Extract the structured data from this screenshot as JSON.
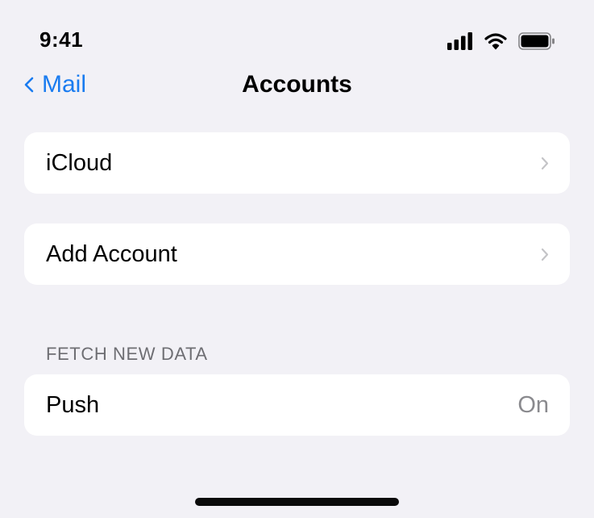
{
  "status_bar": {
    "time": "9:41",
    "icons": [
      "cellular-signal-icon",
      "wifi-icon",
      "battery-icon"
    ]
  },
  "nav": {
    "back_label": "Mail",
    "title": "Accounts"
  },
  "accounts": [
    {
      "label": "iCloud"
    }
  ],
  "add_account": {
    "label": "Add Account"
  },
  "fetch_section": {
    "header": "FETCH NEW DATA",
    "push_label": "Push",
    "push_value": "On"
  },
  "colors": {
    "accent": "#1a7cf0",
    "background": "#f2f1f6",
    "card": "#ffffff",
    "secondary_text": "#8a8a8e",
    "section_header": "#6e6e73"
  }
}
